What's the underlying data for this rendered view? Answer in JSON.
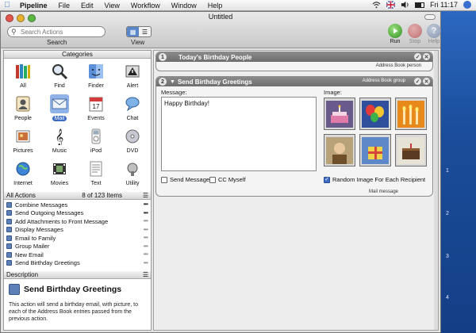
{
  "menubar": {
    "items": [
      "Pipeline",
      "File",
      "Edit",
      "View",
      "Workflow",
      "Window",
      "Help"
    ],
    "clock": "Fri 11:17"
  },
  "window": {
    "title": "Untitled"
  },
  "toolbar": {
    "search_placeholder": "Search Actions",
    "search_label": "Search",
    "view_label": "View",
    "run_label": "Run",
    "stop_label": "Stop",
    "help_label": "Help"
  },
  "categories": {
    "header": "Categories",
    "items": [
      {
        "label": "All",
        "icon": "books-icon"
      },
      {
        "label": "Find",
        "icon": "magnifier-icon"
      },
      {
        "label": "Finder",
        "icon": "finder-icon"
      },
      {
        "label": "Alert",
        "icon": "alert-icon"
      },
      {
        "label": "People",
        "icon": "people-icon"
      },
      {
        "label": "Mail",
        "icon": "mail-icon"
      },
      {
        "label": "Events",
        "icon": "calendar-icon"
      },
      {
        "label": "Chat",
        "icon": "chat-icon"
      },
      {
        "label": "Pictures",
        "icon": "pictures-icon"
      },
      {
        "label": "Music",
        "icon": "music-icon"
      },
      {
        "label": "iPod",
        "icon": "ipod-icon"
      },
      {
        "label": "DVD",
        "icon": "dvd-icon"
      },
      {
        "label": "Internet",
        "icon": "globe-icon"
      },
      {
        "label": "Movies",
        "icon": "film-icon"
      },
      {
        "label": "Text",
        "icon": "text-icon"
      },
      {
        "label": "Utility",
        "icon": "utility-icon"
      }
    ],
    "selected": "Mail"
  },
  "actions": {
    "header": "All Actions",
    "count": "8 of 123 Items",
    "items": [
      "Combine Messages",
      "Send Outgoing Messages",
      "Add Attachments to Front Message",
      "Display Messages",
      "Email to Family",
      "Group Mailer",
      "New Email",
      "Send Birthday Greetings"
    ]
  },
  "description": {
    "header": "Description",
    "title": "Send Birthday Greetings",
    "body": "This action will send a birthday email, with picture, to each of the Address Book entries passed from the previous action."
  },
  "workflow": {
    "step1": {
      "number": "1",
      "title": "Today's Birthday People",
      "type": "Address Book person"
    },
    "step2": {
      "number": "2",
      "title": "Send Birthday Greetings",
      "type_top": "Address Book group",
      "message_label": "Message:",
      "message_text": "Happy Birthday!",
      "image_label": "Image:",
      "send_messages": "Send Messages",
      "cc_myself": "CC Myself",
      "random_image": "Random Image For Each Recipient",
      "type_bottom": "Mail message"
    }
  },
  "desktop_numbers": [
    "1",
    "2",
    "3",
    "4"
  ]
}
